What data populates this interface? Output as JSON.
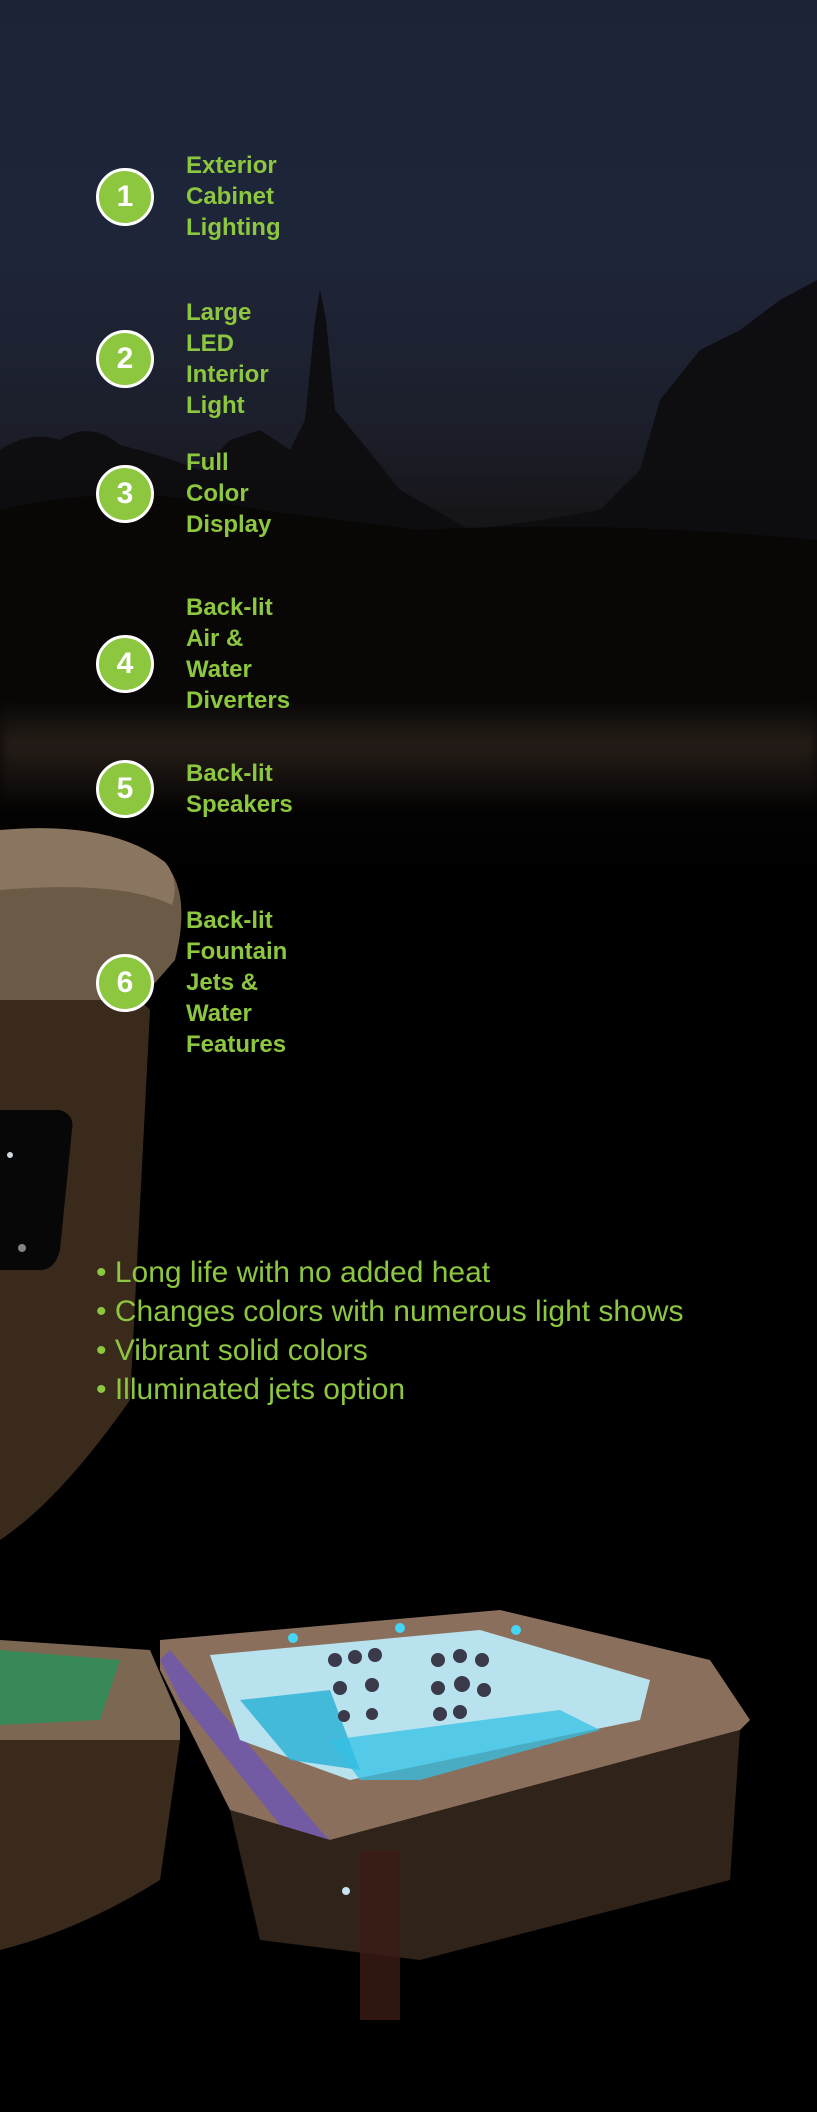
{
  "features": [
    {
      "number": "1",
      "label": "Exterior Cabinet Lighting"
    },
    {
      "number": "2",
      "label": "Large LED Interior Light"
    },
    {
      "number": "3",
      "label": "Full Color Display"
    },
    {
      "number": "4",
      "label": "Back-lit Air & Water Diverters"
    },
    {
      "number": "5",
      "label": "Back-lit Speakers"
    },
    {
      "number": "6",
      "label": "Back-lit Fountain Jets &\nWater Features"
    }
  ],
  "benefits": [
    "Long life with no added heat",
    "Changes colors with numerous light shows",
    "Vibrant solid colors",
    "Illuminated jets option"
  ],
  "colors": {
    "accent_green": "#8dc63f",
    "badge_border": "#ffffff",
    "background": "#000000"
  }
}
